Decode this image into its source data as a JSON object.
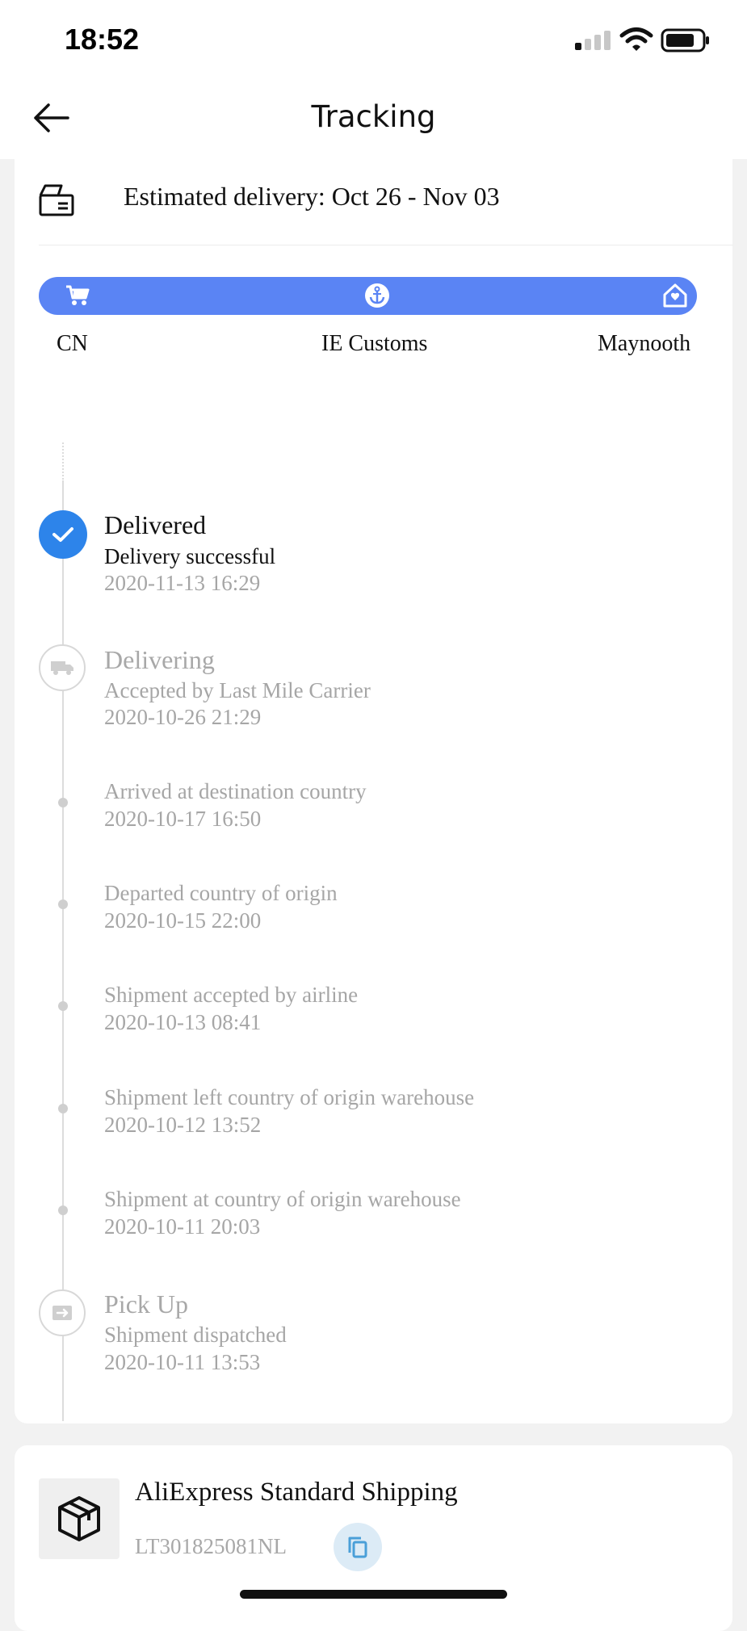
{
  "status_bar": {
    "time": "18:52"
  },
  "nav": {
    "title": "Tracking"
  },
  "estimate": {
    "text": "Estimated delivery: Oct 26 - Nov 03"
  },
  "route": {
    "origin": "CN",
    "customs": "IE Customs",
    "destination": "Maynooth"
  },
  "events": [
    {
      "title": "Delivered",
      "desc": "Delivery successful",
      "time": "2020-11-13 16:29"
    },
    {
      "title": "Delivering",
      "desc": "Accepted by Last Mile Carrier",
      "time": "2020-10-26 21:29"
    },
    {
      "desc": "Arrived at destination country",
      "time": "2020-10-17 16:50"
    },
    {
      "desc": "Departed country of origin",
      "time": "2020-10-15 22:00"
    },
    {
      "desc": "Shipment accepted by airline",
      "time": "2020-10-13 08:41"
    },
    {
      "desc": "Shipment left country of origin warehouse",
      "time": "2020-10-12 13:52"
    },
    {
      "desc": "Shipment at country of origin warehouse",
      "time": "2020-10-11 20:03"
    },
    {
      "title": "Pick Up",
      "desc": "Shipment dispatched",
      "time": "2020-10-11 13:53"
    }
  ],
  "shipping": {
    "carrier": "AliExpress Standard Shipping",
    "tracking_number": "LT301825081NL"
  },
  "colors": {
    "accent": "#5a84f4",
    "check": "#2d84ea"
  }
}
